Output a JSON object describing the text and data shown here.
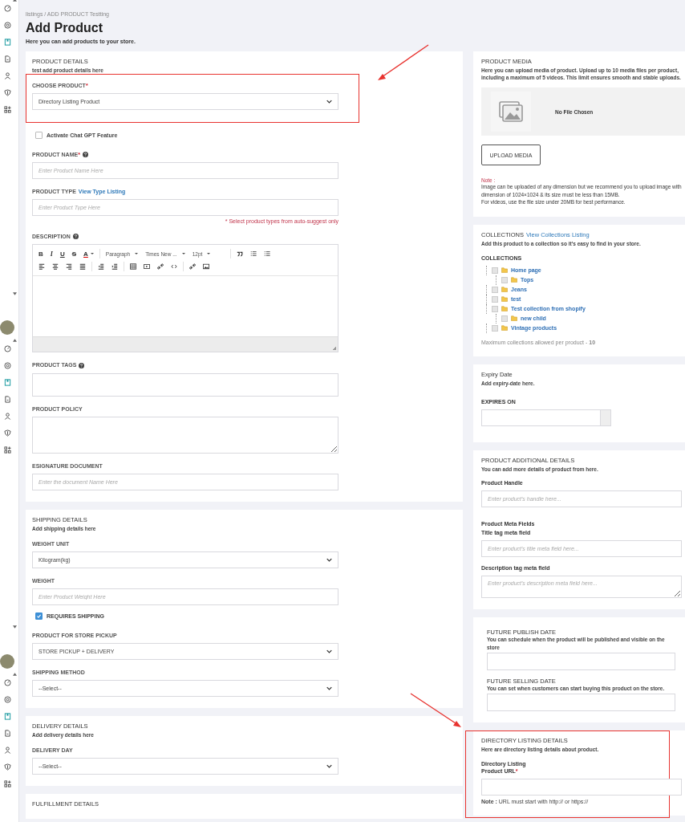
{
  "breadcrumb": "listings / ADD PRODUCT Testting",
  "title": "Add Product",
  "subtitle": "Here you can add products to your store.",
  "left": [
    {
      "title": "PRODUCT DETAILS",
      "subtitle": "test add product details here",
      "fields": [
        {
          "kind": "select",
          "label": "CHOOSE PRODUCT",
          "required": "*",
          "value": "Directory Listing Product",
          "highlighted": true
        },
        {
          "kind": "checkbox",
          "label": "Activate Chat GPT Feature",
          "checked": false
        },
        {
          "kind": "input",
          "label": "PRODUCT NAME",
          "required": "*",
          "help": true,
          "placeholder": "Enter Product Name Here"
        },
        {
          "kind": "input",
          "label": "PRODUCT TYPE",
          "link": "View Type Listing",
          "placeholder": "Enter Product Type Here",
          "hint": "* Select product types from auto-suggest only"
        },
        {
          "kind": "editor",
          "label": "DESCRIPTION",
          "help": true,
          "toolbar": [
            [
              [
                {
                  "kind": "bold",
                  "label": "B"
                },
                {
                  "kind": "italic",
                  "label": "I"
                },
                {
                  "kind": "underline",
                  "label": "U"
                },
                {
                  "kind": "strike",
                  "label": "S"
                },
                {
                  "kind": "color",
                  "label": "A"
                }
              ],
              [
                {
                  "kind": "dropdown",
                  "label": "Paragraph"
                },
                {
                  "kind": "dropdown",
                  "label": "Times New ..."
                },
                {
                  "kind": "dropdown",
                  "label": "12pt"
                }
              ],
              [
                {
                  "kind": "quote"
                },
                {
                  "kind": "bullets"
                },
                {
                  "kind": "numbers"
                }
              ]
            ],
            [
              [
                {
                  "kind": "align-left"
                },
                {
                  "kind": "align-center"
                },
                {
                  "kind": "align-right"
                },
                {
                  "kind": "justify"
                }
              ],
              [
                {
                  "kind": "outdent"
                },
                {
                  "kind": "indent"
                }
              ],
              [
                {
                  "kind": "table"
                },
                {
                  "kind": "media"
                },
                {
                  "kind": "link"
                },
                {
                  "kind": "code"
                }
              ],
              [
                {
                  "kind": "unlink"
                },
                {
                  "kind": "image"
                }
              ]
            ]
          ]
        },
        {
          "kind": "tags",
          "label": "PRODUCT TAGS",
          "help": true
        },
        {
          "kind": "textarea",
          "label": "PRODUCT POLICY"
        },
        {
          "kind": "input",
          "label": "ESIGNATURE DOCUMENT",
          "placeholder": "Enter the document Name Here"
        }
      ]
    },
    {
      "title": "SHIPPING DETAILS",
      "subtitle": "Add shipping details here",
      "fields": [
        {
          "kind": "select",
          "label": "WEIGHT UNIT",
          "value": "Kilogram(kg)"
        },
        {
          "kind": "input",
          "label": "WEIGHT",
          "placeholder": "Enter Product Weight Here"
        },
        {
          "kind": "checkbox",
          "label": "REQUIRES SHIPPING",
          "checked": true
        },
        {
          "kind": "select",
          "label": "PRODUCT FOR STORE PICKUP",
          "value": "STORE PICKUP + DELIVERY"
        },
        {
          "kind": "select",
          "label": "SHIPPING METHOD",
          "value": "--Select--"
        }
      ]
    },
    {
      "title": "DELIVERY DETAILS",
      "subtitle": "Add delivery details here",
      "fields": [
        {
          "kind": "select",
          "label": "DELIVERY DAY",
          "value": "--Select--"
        }
      ]
    },
    {
      "title": "FULFILLMENT DETAILS"
    }
  ],
  "right": [
    {
      "title": "PRODUCT MEDIA",
      "subtitle": "Here you can upload media of product. Upload up to 10 media files per product, including a maximum of 5 videos. This limit ensures smooth and stable uploads.",
      "fields": [
        {
          "kind": "media",
          "status": "No File Chosen"
        },
        {
          "kind": "button",
          "label": "UPLOAD MEDIA"
        },
        {
          "kind": "note",
          "label": "Note :",
          "lines": [
            "Image can be uploaded of any dimension but we recommend you to upload image with dimension of 1024×1024 & its size must be less than 15MB.",
            "For videos, use the file size under 20MB for best performance."
          ]
        }
      ]
    },
    {
      "title": "COLLECTIONS",
      "link": "View Collections Listing",
      "subtitle": "Add this product to a collection so it's easy to find in your store.",
      "fields": [
        {
          "kind": "tree",
          "label": "COLLECTIONS",
          "footer": "Maximum collections allowed per product - **10**",
          "items": [
            {
              "label": "Home page",
              "checked": false,
              "children": [
                {
                  "label": "Tops",
                  "checked": false
                }
              ]
            },
            {
              "label": "Jeans",
              "checked": false
            },
            {
              "label": "test",
              "checked": false
            },
            {
              "label": "Test collection from shopify",
              "checked": false,
              "children": [
                {
                  "label": "new child",
                  "checked": false
                }
              ]
            },
            {
              "label": "Vintage products",
              "checked": false
            }
          ]
        }
      ]
    },
    {
      "title": "Expiry Date",
      "subtitle": "Add expiry-date here.",
      "fields": [
        {
          "kind": "date",
          "label": "EXPIRES ON"
        }
      ]
    },
    {
      "title": "PRODUCT ADDITIONAL DETAILS",
      "subtitle": "You can add more details of product from here.",
      "fields": [
        {
          "kind": "input",
          "label": "Product Handle",
          "placeholder": "Enter product's handle here..."
        },
        {
          "kind": "heading",
          "label": "Product Meta Fields"
        },
        {
          "kind": "input",
          "label": "Title tag meta field",
          "placeholder": "Enter product's title meta field here..."
        },
        {
          "kind": "textarea",
          "label": "Description tag meta field",
          "placeholder": "Enter product's description meta field here..."
        }
      ]
    },
    {
      "fields": [
        {
          "kind": "section",
          "label": "FUTURE PUBLISH DATE",
          "description": "You can schedule when the product will be published and visible on the store"
        },
        {
          "kind": "section",
          "label": "FUTURE SELLING DATE",
          "description": "You can set when customers can start buying this product on the store."
        }
      ]
    },
    {
      "title": "DIRECTORY LISTING DETAILS",
      "subtitle": "Here are directory listing details about product.",
      "highlighted": true,
      "fields": [
        {
          "kind": "input",
          "label": [
            "Directory Listing",
            "Product URL"
          ],
          "required": "*",
          "note": "**Note :** URL must start with http:// or https://"
        }
      ]
    }
  ]
}
